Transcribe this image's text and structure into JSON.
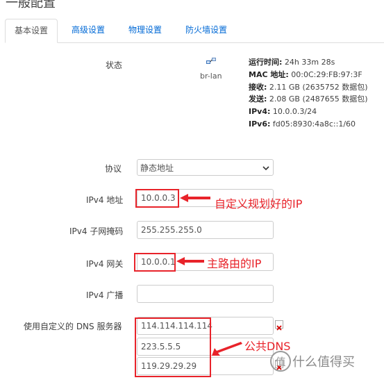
{
  "section": {
    "title": "一般配置"
  },
  "tabs": [
    {
      "label": "基本设置",
      "active": true
    },
    {
      "label": "高级设置",
      "active": false
    },
    {
      "label": "物理设置",
      "active": false
    },
    {
      "label": "防火墙设置",
      "active": false
    }
  ],
  "status": {
    "label": "状态",
    "device": "br-lan",
    "uptime_label": "运行时间:",
    "uptime": " 24h 33m 28s",
    "mac_label": "MAC 地址:",
    "mac": " 00:0C:29:FB:97:3F",
    "rx_label": "接收:",
    "rx": " 2.11 GB (2635752 数据包)",
    "tx_label": "发送:",
    "tx": " 2.08 GB (2487655 数据包)",
    "ipv4_label": "IPv4:",
    "ipv4": " 10.0.0.3/24",
    "ipv6_label": "IPv6:",
    "ipv6": " fd05:8930:4a8c::1/60"
  },
  "protocol": {
    "label": "协议",
    "value": "静态地址"
  },
  "ipv4_addr": {
    "label": "IPv4 地址",
    "value": "10.0.0.3"
  },
  "netmask": {
    "label": "IPv4 子网掩码",
    "value": "255.255.255.0"
  },
  "gateway": {
    "label": "IPv4 网关",
    "value": "10.0.0.1"
  },
  "broadcast": {
    "label": "IPv4 广播",
    "value": ""
  },
  "dns": {
    "label": "使用自定义的 DNS 服务器",
    "servers": [
      "114.114.114.114",
      "223.5.5.5",
      "119.29.29.29"
    ]
  },
  "annotations": {
    "ip_note": "自定义规划好的IP",
    "gateway_note": "主路由的IP",
    "dns_note": "公共DNS"
  },
  "colors": {
    "annotation": "#e8232a",
    "tab_link": "#0069d6"
  },
  "watermark": {
    "logo_icon": "zhi-logo",
    "text": "什么值得买"
  }
}
